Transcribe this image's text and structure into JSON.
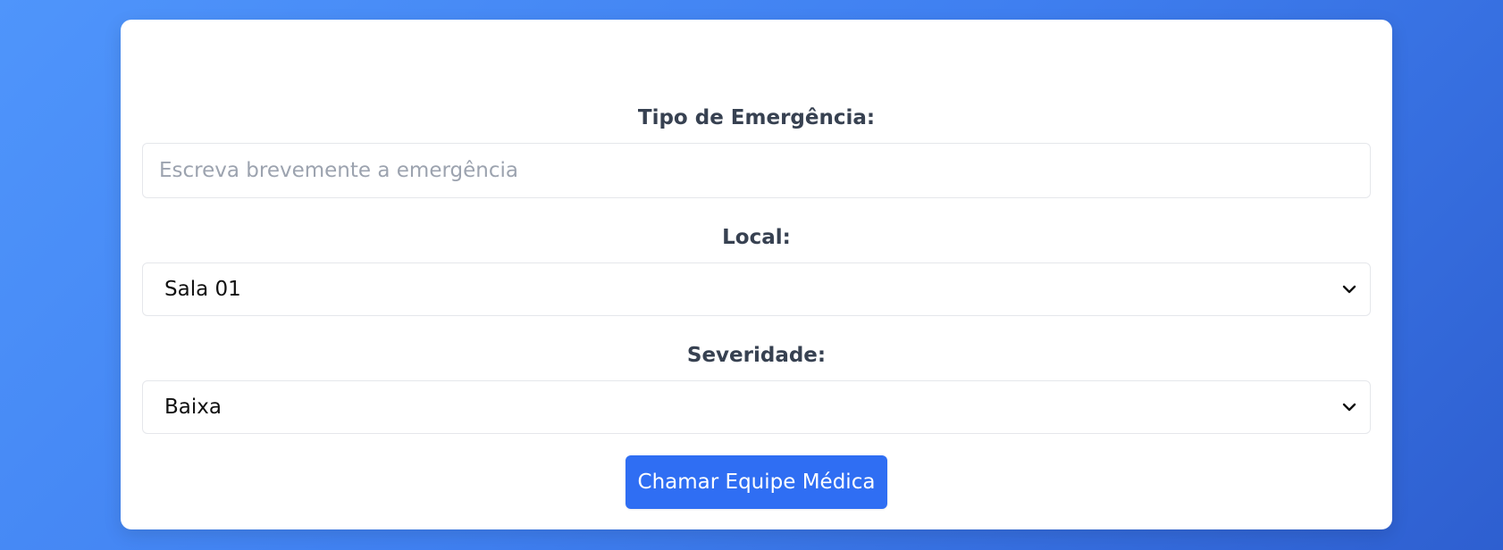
{
  "form": {
    "emergency_type": {
      "label": "Tipo de Emergência:",
      "value": "",
      "placeholder": "Escreva brevemente a emergência"
    },
    "location": {
      "label": "Local:",
      "selected": "Sala 01"
    },
    "severity": {
      "label": "Severidade:",
      "selected": "Baixa"
    },
    "submit_label": "Chamar Equipe Médica"
  },
  "colors": {
    "primary_button": "#2f6ef3",
    "label_text": "#374151",
    "placeholder_text": "#9ca3af",
    "background_gradient_start": "#4f95fb",
    "background_gradient_end": "#2e5fd0"
  },
  "icons": {
    "select_arrow": "chevron-down-icon"
  }
}
